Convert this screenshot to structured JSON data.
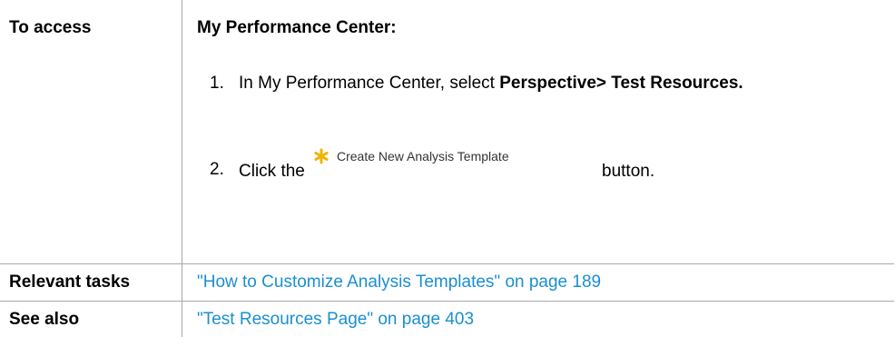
{
  "rows": {
    "access": {
      "label": "To access",
      "title": "My Performance Center:",
      "step1": {
        "number": "1.",
        "text_prefix": "In My Performance Center, select ",
        "text_bold": "Perspective> Test Resources."
      },
      "step2": {
        "number": "2.",
        "text_before": "Click the",
        "button_label": "Create New Analysis Template",
        "button_icon": "asterisk-icon",
        "text_after": "button."
      }
    },
    "relevant_tasks": {
      "label": "Relevant tasks",
      "link_text": "\"How to Customize Analysis Templates\" on page 189"
    },
    "see_also": {
      "label": "See also",
      "link_text": "\"Test Resources Page\" on page 403"
    }
  },
  "colors": {
    "link": "#1a8fd0",
    "border": "#a8a8a8",
    "icon": "#f0b400"
  }
}
